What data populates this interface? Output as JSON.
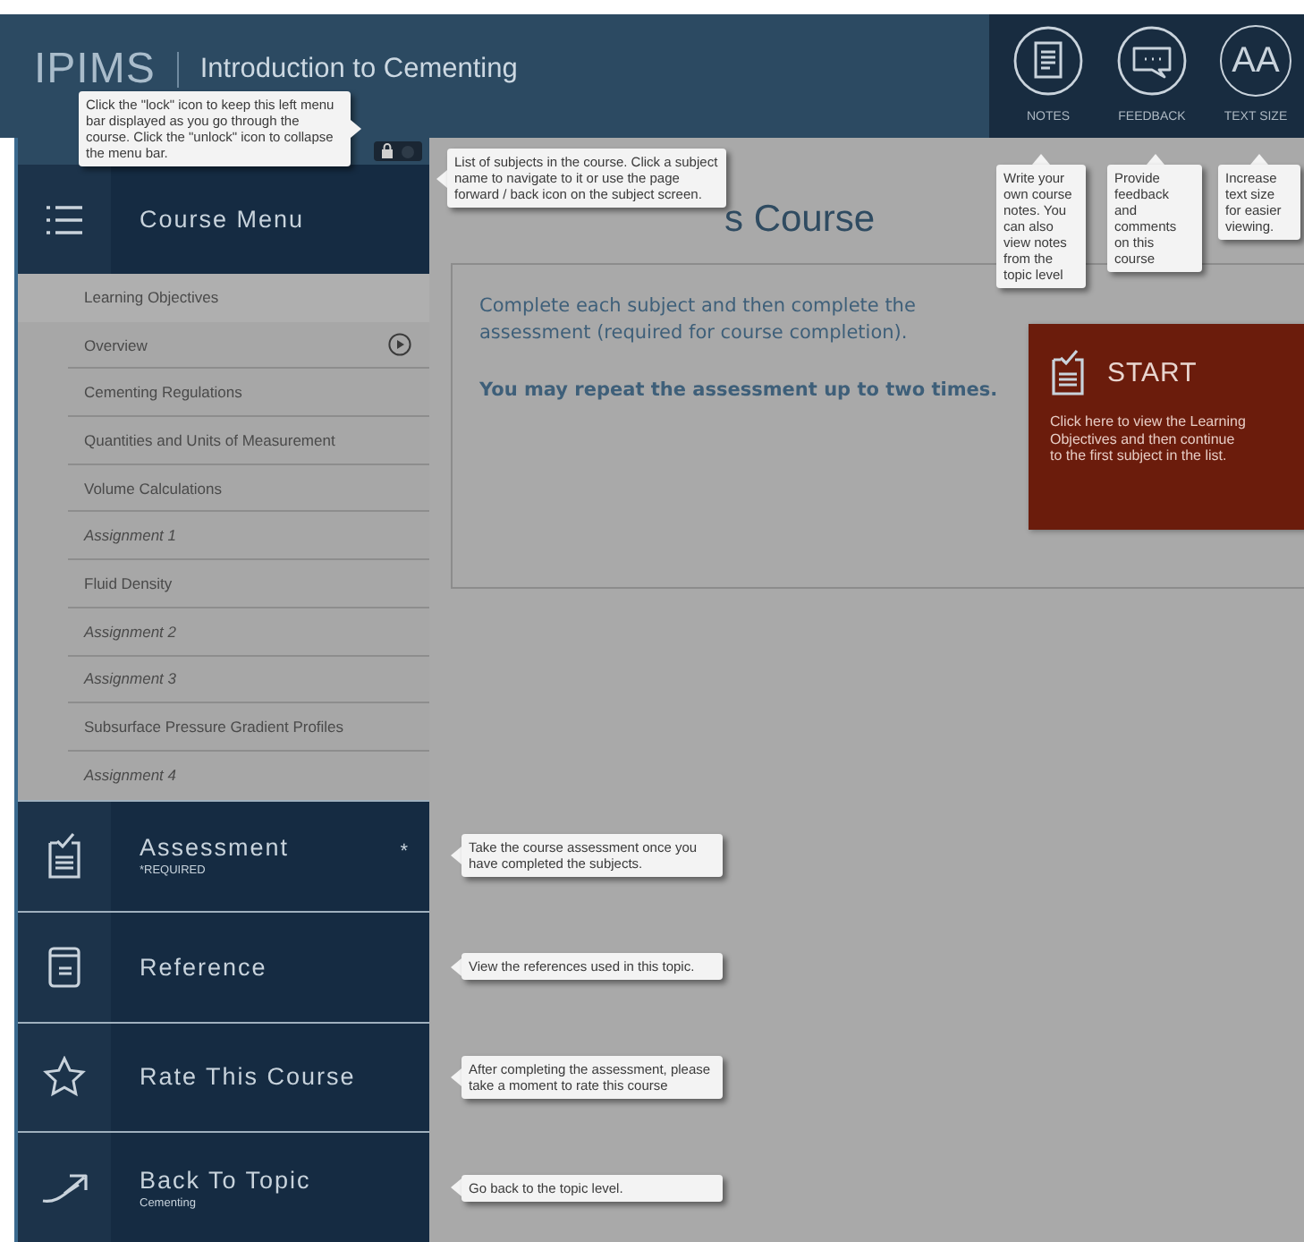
{
  "header": {
    "logo": "IPIMS",
    "title": "Introduction to Cementing"
  },
  "toolbar": [
    {
      "kind": "notes",
      "label": "NOTES",
      "tooltip": "Write your own course notes. You can also view notes from the topic level"
    },
    {
      "kind": "feedback",
      "label": "FEEDBACK",
      "tooltip": "Provide feedback and comments on this course"
    },
    {
      "kind": "text_size",
      "label": "TEXT SIZE",
      "glyph": "AA",
      "tooltip": "Increase text size for easier viewing."
    }
  ],
  "sidebar": {
    "locked": true,
    "lock_tooltip": "Click the \"lock\" icon to keep this left menu bar displayed as you go through the course. Click the \"unlock\" icon to collapse the menu bar.",
    "course_menu": {
      "title": "Course Menu",
      "tooltip": "List of subjects in the course. Click a subject name to navigate to it or use the page forward / back icon on the subject screen."
    },
    "subjects": [
      {
        "label": "Learning Objectives",
        "kind": "objectives",
        "current": false
      },
      {
        "label": "Overview",
        "kind": "subject",
        "current": true
      },
      {
        "label": "Cementing Regulations",
        "kind": "subject",
        "current": false
      },
      {
        "label": "Quantities and Units of Measurement",
        "kind": "subject",
        "current": false
      },
      {
        "label": "Volume Calculations",
        "kind": "subject",
        "current": false
      },
      {
        "label": "Assignment 1",
        "kind": "assignment",
        "current": false
      },
      {
        "label": "Fluid Density",
        "kind": "subject",
        "current": false
      },
      {
        "label": "Assignment 2",
        "kind": "assignment",
        "current": false
      },
      {
        "label": "Assignment 3",
        "kind": "assignment",
        "current": false
      },
      {
        "label": "Subsurface Pressure Gradient Profiles",
        "kind": "subject",
        "current": false
      },
      {
        "label": "Assignment 4",
        "kind": "assignment",
        "current": false
      }
    ],
    "nav": [
      {
        "kind": "assessment",
        "title": "Assessment",
        "subtitle": "*REQUIRED",
        "marker": "*",
        "tooltip": "Take the course assessment once you have completed the subjects."
      },
      {
        "kind": "reference",
        "title": "Reference",
        "tooltip": "View the references used in this topic."
      },
      {
        "kind": "rate",
        "title": "Rate This Course",
        "tooltip": "After completing the assessment, please take a moment to rate this course"
      },
      {
        "kind": "back",
        "title": "Back To Topic",
        "subtitle": "Cementing",
        "tooltip": "Go back to the topic level."
      }
    ]
  },
  "main": {
    "title": "s Course",
    "intro": "Complete each subject and then complete the assessment (required for course completion).",
    "note": "You may repeat the assessment up to two times.",
    "start": {
      "label": "START",
      "description": "Click here to view the Learning Objectives and then continue to the first subject in the list."
    }
  }
}
